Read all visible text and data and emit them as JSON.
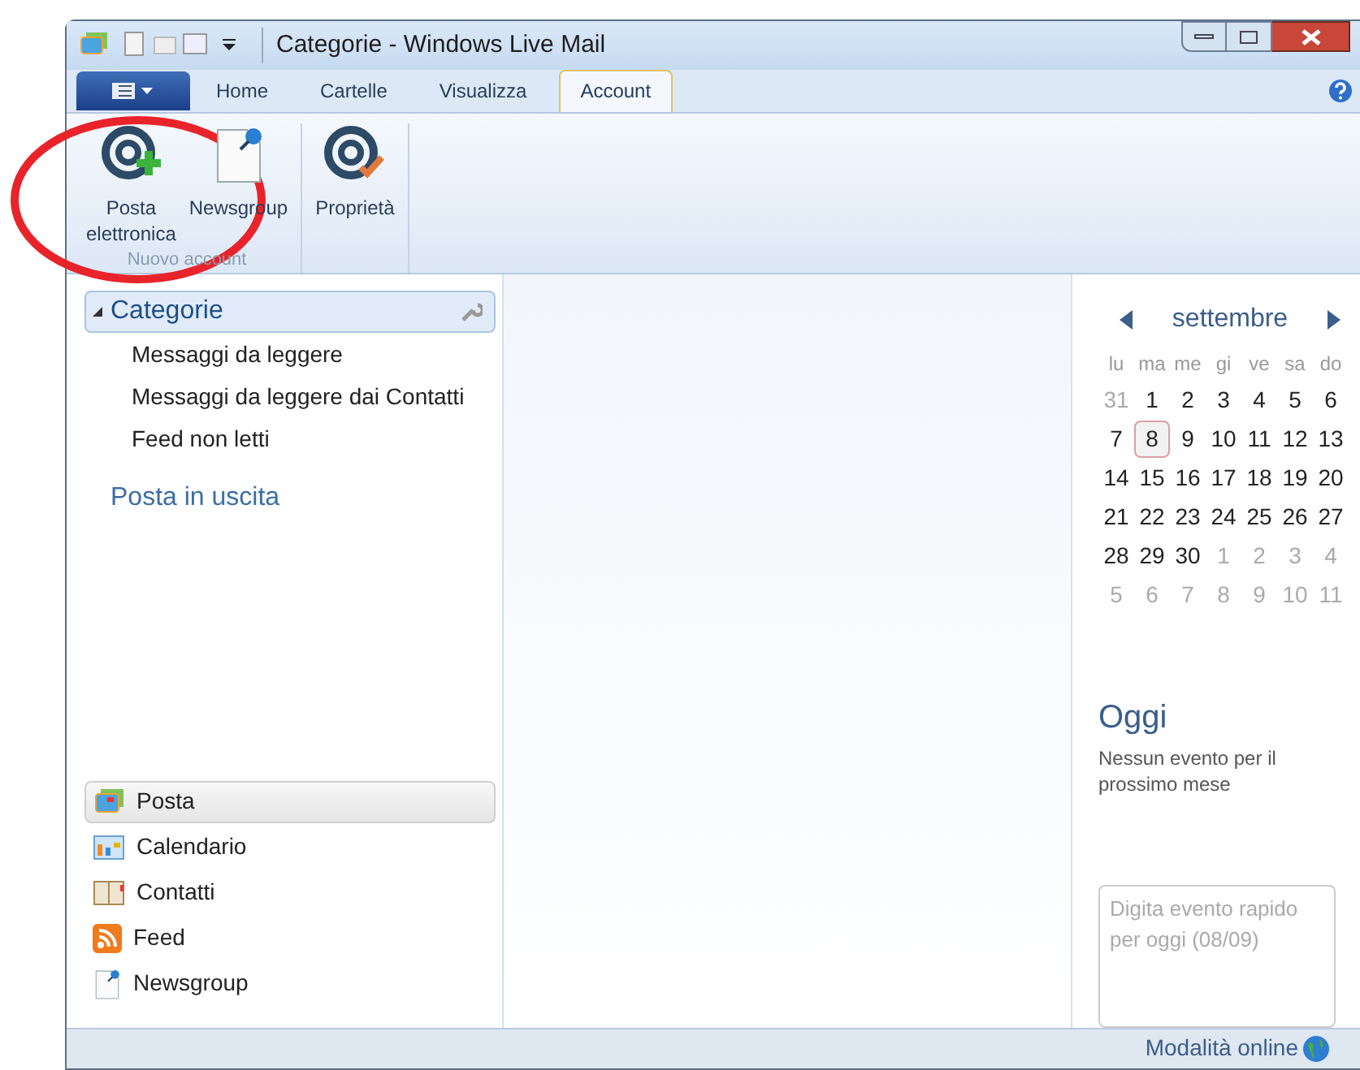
{
  "window": {
    "title": "Categorie - Windows Live Mail"
  },
  "tabs": [
    {
      "label": "Home",
      "selected": false
    },
    {
      "label": "Cartelle",
      "selected": false
    },
    {
      "label": "Visualizza",
      "selected": false
    },
    {
      "label": "Account",
      "selected": true
    }
  ],
  "ribbon": {
    "groups": [
      {
        "label": "Nuovo account",
        "buttons": [
          {
            "kind": "email",
            "label": "Posta\nelettronica"
          },
          {
            "kind": "newsgroup",
            "label": "Newsgroup"
          }
        ]
      },
      {
        "buttons": [
          {
            "kind": "properties",
            "label": "Proprietà"
          }
        ]
      }
    ]
  },
  "folders": {
    "title": "Categorie",
    "expanded": true,
    "items": [
      "Messaggi da leggere",
      "Messaggi da leggere dai Contatti",
      "Feed non letti"
    ],
    "outbox": "Posta in uscita"
  },
  "nav": [
    {
      "kind": "mail",
      "label": "Posta",
      "selected": true
    },
    {
      "kind": "calendar",
      "label": "Calendario",
      "selected": false
    },
    {
      "kind": "contacts",
      "label": "Contatti",
      "selected": false
    },
    {
      "kind": "feed",
      "label": "Feed",
      "selected": false
    },
    {
      "kind": "newsgroup",
      "label": "Newsgroup",
      "selected": false
    }
  ],
  "calendar": {
    "month": "settembre",
    "weekdays": [
      "lu",
      "ma",
      "me",
      "gi",
      "ve",
      "sa",
      "do"
    ],
    "days": [
      {
        "label": "31",
        "muted": true,
        "selected": false
      },
      {
        "label": "1",
        "muted": false,
        "selected": false
      },
      {
        "label": "2",
        "muted": false,
        "selected": false
      },
      {
        "label": "3",
        "muted": false,
        "selected": false
      },
      {
        "label": "4",
        "muted": false,
        "selected": false
      },
      {
        "label": "5",
        "muted": false,
        "selected": false
      },
      {
        "label": "6",
        "muted": false,
        "selected": false
      },
      {
        "label": "7",
        "muted": false,
        "selected": false
      },
      {
        "label": "8",
        "muted": false,
        "selected": true
      },
      {
        "label": "9",
        "muted": false,
        "selected": false
      },
      {
        "label": "10",
        "muted": false,
        "selected": false
      },
      {
        "label": "11",
        "muted": false,
        "selected": false
      },
      {
        "label": "12",
        "muted": false,
        "selected": false
      },
      {
        "label": "13",
        "muted": false,
        "selected": false
      },
      {
        "label": "14",
        "muted": false,
        "selected": false
      },
      {
        "label": "15",
        "muted": false,
        "selected": false
      },
      {
        "label": "16",
        "muted": false,
        "selected": false
      },
      {
        "label": "17",
        "muted": false,
        "selected": false
      },
      {
        "label": "18",
        "muted": false,
        "selected": false
      },
      {
        "label": "19",
        "muted": false,
        "selected": false
      },
      {
        "label": "20",
        "muted": false,
        "selected": false
      },
      {
        "label": "21",
        "muted": false,
        "selected": false
      },
      {
        "label": "22",
        "muted": false,
        "selected": false
      },
      {
        "label": "23",
        "muted": false,
        "selected": false
      },
      {
        "label": "24",
        "muted": false,
        "selected": false
      },
      {
        "label": "25",
        "muted": false,
        "selected": false
      },
      {
        "label": "26",
        "muted": false,
        "selected": false
      },
      {
        "label": "27",
        "muted": false,
        "selected": false
      },
      {
        "label": "28",
        "muted": false,
        "selected": false
      },
      {
        "label": "29",
        "muted": false,
        "selected": false
      },
      {
        "label": "30",
        "muted": false,
        "selected": false
      },
      {
        "label": "1",
        "muted": true,
        "selected": false
      },
      {
        "label": "2",
        "muted": true,
        "selected": false
      },
      {
        "label": "3",
        "muted": true,
        "selected": false
      },
      {
        "label": "4",
        "muted": true,
        "selected": false
      },
      {
        "label": "5",
        "muted": true,
        "selected": false
      },
      {
        "label": "6",
        "muted": true,
        "selected": false
      },
      {
        "label": "7",
        "muted": true,
        "selected": false
      },
      {
        "label": "8",
        "muted": true,
        "selected": false
      },
      {
        "label": "9",
        "muted": true,
        "selected": false
      },
      {
        "label": "10",
        "muted": true,
        "selected": false
      },
      {
        "label": "11",
        "muted": true,
        "selected": false
      }
    ]
  },
  "today": {
    "title": "Oggi",
    "message": "Nessun evento per il prossimo mese",
    "quick_event": {
      "placeholder": "Digita evento rapido per oggi (08/09)"
    }
  },
  "status_bar": {
    "text": "Modalità online"
  }
}
